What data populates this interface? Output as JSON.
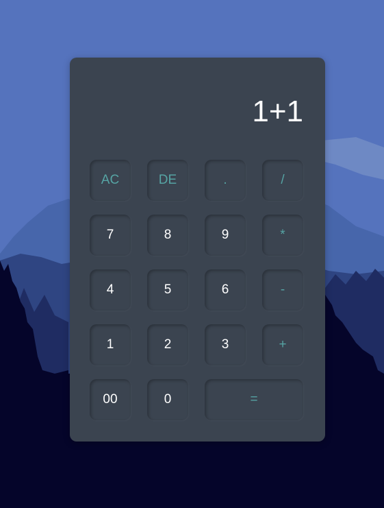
{
  "display": {
    "expression": "1+1"
  },
  "keys": {
    "ac": "AC",
    "de": "DE",
    "dot": ".",
    "divide": "/",
    "k7": "7",
    "k8": "8",
    "k9": "9",
    "multiply": "*",
    "k4": "4",
    "k5": "5",
    "k6": "6",
    "minus": "-",
    "k1": "1",
    "k2": "2",
    "k3": "3",
    "plus": "+",
    "k00": "00",
    "k0": "0",
    "equals": "="
  },
  "colors": {
    "panel": "#3b4450",
    "digit_text": "#ffffff",
    "operator_text": "#56a4a4",
    "sky": "#5573bd",
    "ground": "#05052a"
  }
}
